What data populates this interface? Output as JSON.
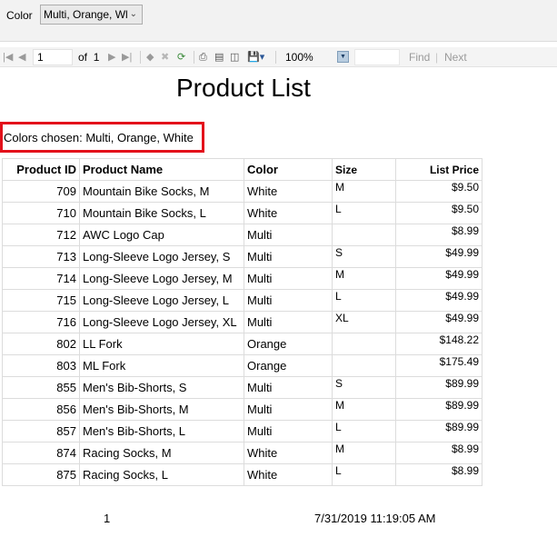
{
  "params": {
    "color_label": "Color",
    "color_value": "Multi, Orange, Wl"
  },
  "toolbar": {
    "page_current": "1",
    "page_of_label": "of",
    "page_total": "1",
    "zoom": "100%",
    "find_label": "Find",
    "separator": "|",
    "next_label": "Next"
  },
  "report": {
    "title": "Product List",
    "colors_chosen": "Colors chosen: Multi, Orange, White",
    "columns": [
      "Product ID",
      "Product Name",
      "Color",
      "Size",
      "List Price"
    ],
    "rows": [
      {
        "id": "709",
        "name": "Mountain Bike Socks, M",
        "color": "White",
        "size": "M",
        "price": "$9.50"
      },
      {
        "id": "710",
        "name": "Mountain Bike Socks, L",
        "color": "White",
        "size": "L",
        "price": "$9.50"
      },
      {
        "id": "712",
        "name": "AWC Logo Cap",
        "color": "Multi",
        "size": "",
        "price": "$8.99"
      },
      {
        "id": "713",
        "name": "Long-Sleeve Logo Jersey, S",
        "color": "Multi",
        "size": "S",
        "price": "$49.99"
      },
      {
        "id": "714",
        "name": "Long-Sleeve Logo Jersey, M",
        "color": "Multi",
        "size": "M",
        "price": "$49.99"
      },
      {
        "id": "715",
        "name": "Long-Sleeve Logo Jersey, L",
        "color": "Multi",
        "size": "L",
        "price": "$49.99"
      },
      {
        "id": "716",
        "name": "Long-Sleeve Logo Jersey, XL",
        "color": "Multi",
        "size": "XL",
        "price": "$49.99"
      },
      {
        "id": "802",
        "name": "LL Fork",
        "color": "Orange",
        "size": "",
        "price": "$148.22"
      },
      {
        "id": "803",
        "name": "ML Fork",
        "color": "Orange",
        "size": "",
        "price": "$175.49"
      },
      {
        "id": "855",
        "name": "Men's Bib-Shorts, S",
        "color": "Multi",
        "size": "S",
        "price": "$89.99"
      },
      {
        "id": "856",
        "name": "Men's Bib-Shorts, M",
        "color": "Multi",
        "size": "M",
        "price": "$89.99"
      },
      {
        "id": "857",
        "name": "Men's Bib-Shorts, L",
        "color": "Multi",
        "size": "L",
        "price": "$89.99"
      },
      {
        "id": "874",
        "name": "Racing Socks, M",
        "color": "White",
        "size": "M",
        "price": "$8.99"
      },
      {
        "id": "875",
        "name": "Racing Socks, L",
        "color": "White",
        "size": "L",
        "price": "$8.99"
      }
    ],
    "footer_page": "1",
    "footer_datetime": "7/31/2019 11:19:05 AM"
  },
  "highlight_color": "#e3111b"
}
